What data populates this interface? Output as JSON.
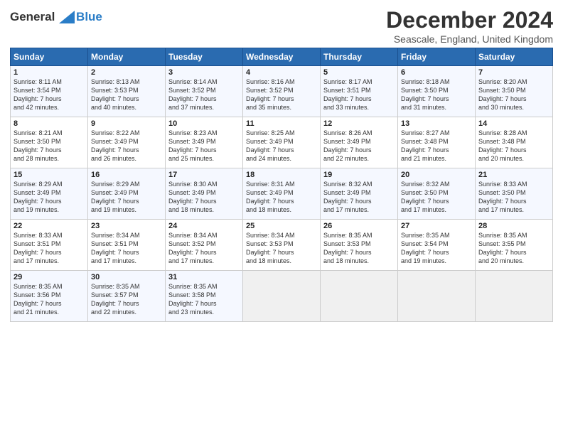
{
  "header": {
    "logo_line1": "General",
    "logo_line2": "Blue",
    "month": "December 2024",
    "location": "Seascale, England, United Kingdom"
  },
  "days_of_week": [
    "Sunday",
    "Monday",
    "Tuesday",
    "Wednesday",
    "Thursday",
    "Friday",
    "Saturday"
  ],
  "weeks": [
    [
      {
        "day": "1",
        "sunrise": "8:11 AM",
        "sunset": "3:54 PM",
        "daylight": "7 hours and 42 minutes."
      },
      {
        "day": "2",
        "sunrise": "8:13 AM",
        "sunset": "3:53 PM",
        "daylight": "7 hours and 40 minutes."
      },
      {
        "day": "3",
        "sunrise": "8:14 AM",
        "sunset": "3:52 PM",
        "daylight": "7 hours and 37 minutes."
      },
      {
        "day": "4",
        "sunrise": "8:16 AM",
        "sunset": "3:52 PM",
        "daylight": "7 hours and 35 minutes."
      },
      {
        "day": "5",
        "sunrise": "8:17 AM",
        "sunset": "3:51 PM",
        "daylight": "7 hours and 33 minutes."
      },
      {
        "day": "6",
        "sunrise": "8:18 AM",
        "sunset": "3:50 PM",
        "daylight": "7 hours and 31 minutes."
      },
      {
        "day": "7",
        "sunrise": "8:20 AM",
        "sunset": "3:50 PM",
        "daylight": "7 hours and 30 minutes."
      }
    ],
    [
      {
        "day": "8",
        "sunrise": "8:21 AM",
        "sunset": "3:50 PM",
        "daylight": "7 hours and 28 minutes."
      },
      {
        "day": "9",
        "sunrise": "8:22 AM",
        "sunset": "3:49 PM",
        "daylight": "7 hours and 26 minutes."
      },
      {
        "day": "10",
        "sunrise": "8:23 AM",
        "sunset": "3:49 PM",
        "daylight": "7 hours and 25 minutes."
      },
      {
        "day": "11",
        "sunrise": "8:25 AM",
        "sunset": "3:49 PM",
        "daylight": "7 hours and 24 minutes."
      },
      {
        "day": "12",
        "sunrise": "8:26 AM",
        "sunset": "3:49 PM",
        "daylight": "7 hours and 22 minutes."
      },
      {
        "day": "13",
        "sunrise": "8:27 AM",
        "sunset": "3:48 PM",
        "daylight": "7 hours and 21 minutes."
      },
      {
        "day": "14",
        "sunrise": "8:28 AM",
        "sunset": "3:48 PM",
        "daylight": "7 hours and 20 minutes."
      }
    ],
    [
      {
        "day": "15",
        "sunrise": "8:29 AM",
        "sunset": "3:49 PM",
        "daylight": "7 hours and 19 minutes."
      },
      {
        "day": "16",
        "sunrise": "8:29 AM",
        "sunset": "3:49 PM",
        "daylight": "7 hours and 19 minutes."
      },
      {
        "day": "17",
        "sunrise": "8:30 AM",
        "sunset": "3:49 PM",
        "daylight": "7 hours and 18 minutes."
      },
      {
        "day": "18",
        "sunrise": "8:31 AM",
        "sunset": "3:49 PM",
        "daylight": "7 hours and 18 minutes."
      },
      {
        "day": "19",
        "sunrise": "8:32 AM",
        "sunset": "3:49 PM",
        "daylight": "7 hours and 17 minutes."
      },
      {
        "day": "20",
        "sunrise": "8:32 AM",
        "sunset": "3:50 PM",
        "daylight": "7 hours and 17 minutes."
      },
      {
        "day": "21",
        "sunrise": "8:33 AM",
        "sunset": "3:50 PM",
        "daylight": "7 hours and 17 minutes."
      }
    ],
    [
      {
        "day": "22",
        "sunrise": "8:33 AM",
        "sunset": "3:51 PM",
        "daylight": "7 hours and 17 minutes."
      },
      {
        "day": "23",
        "sunrise": "8:34 AM",
        "sunset": "3:51 PM",
        "daylight": "7 hours and 17 minutes."
      },
      {
        "day": "24",
        "sunrise": "8:34 AM",
        "sunset": "3:52 PM",
        "daylight": "7 hours and 17 minutes."
      },
      {
        "day": "25",
        "sunrise": "8:34 AM",
        "sunset": "3:53 PM",
        "daylight": "7 hours and 18 minutes."
      },
      {
        "day": "26",
        "sunrise": "8:35 AM",
        "sunset": "3:53 PM",
        "daylight": "7 hours and 18 minutes."
      },
      {
        "day": "27",
        "sunrise": "8:35 AM",
        "sunset": "3:54 PM",
        "daylight": "7 hours and 19 minutes."
      },
      {
        "day": "28",
        "sunrise": "8:35 AM",
        "sunset": "3:55 PM",
        "daylight": "7 hours and 20 minutes."
      }
    ],
    [
      {
        "day": "29",
        "sunrise": "8:35 AM",
        "sunset": "3:56 PM",
        "daylight": "7 hours and 21 minutes."
      },
      {
        "day": "30",
        "sunrise": "8:35 AM",
        "sunset": "3:57 PM",
        "daylight": "7 hours and 22 minutes."
      },
      {
        "day": "31",
        "sunrise": "8:35 AM",
        "sunset": "3:58 PM",
        "daylight": "7 hours and 23 minutes."
      },
      null,
      null,
      null,
      null
    ]
  ],
  "labels": {
    "sunrise_prefix": "Sunrise: ",
    "sunset_prefix": "Sunset: ",
    "daylight_label": "Daylight: "
  }
}
